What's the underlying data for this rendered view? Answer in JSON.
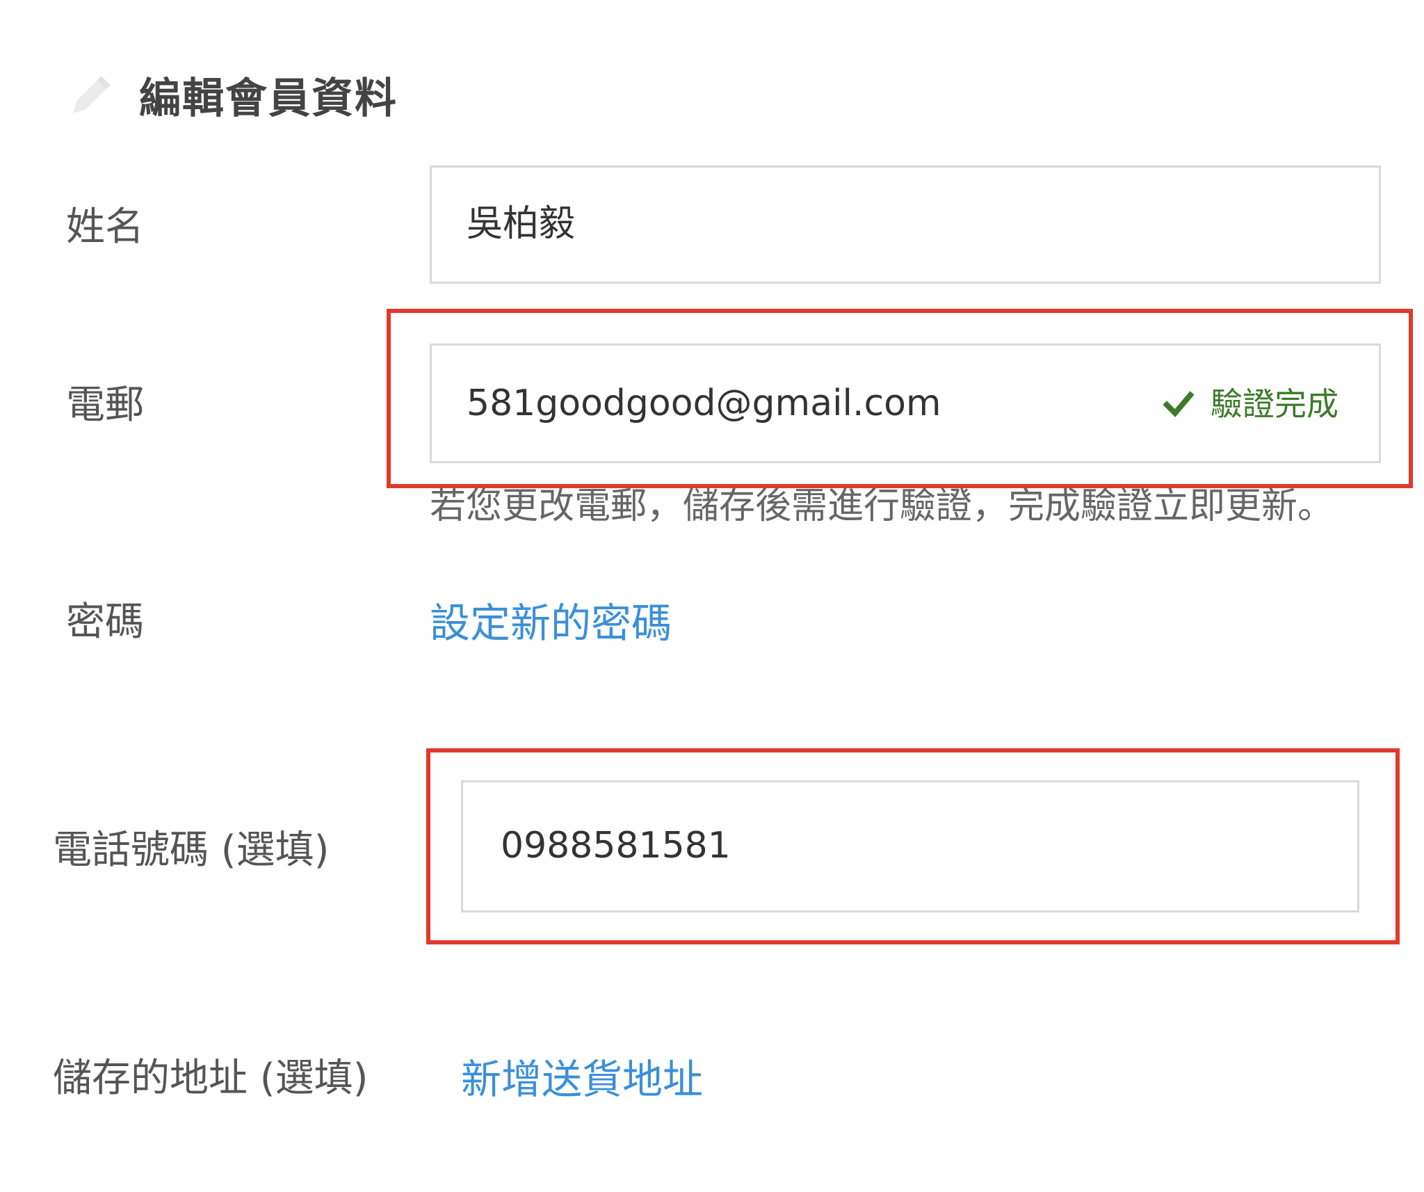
{
  "header": {
    "title": "編輯會員資料",
    "icon": "pencil-icon"
  },
  "form": {
    "name": {
      "label": "姓名",
      "value": "吳柏毅"
    },
    "email": {
      "label": "電郵",
      "value": "581goodgood@gmail.com",
      "status_icon": "check-icon",
      "status_text": "驗證完成",
      "helper_text": "若您更改電郵，儲存後需進行驗證，完成驗證立即更新。"
    },
    "password": {
      "label": "密碼",
      "link_text": "設定新的密碼"
    },
    "phone": {
      "label": "電話號碼 (選填)",
      "value": "0988581581"
    },
    "address": {
      "label": "儲存的地址 (選填)",
      "link_text": "新增送貨地址"
    }
  },
  "colors": {
    "highlight": "#e03a2a",
    "link": "#3a8fd9",
    "verified": "#3d7a2c"
  }
}
